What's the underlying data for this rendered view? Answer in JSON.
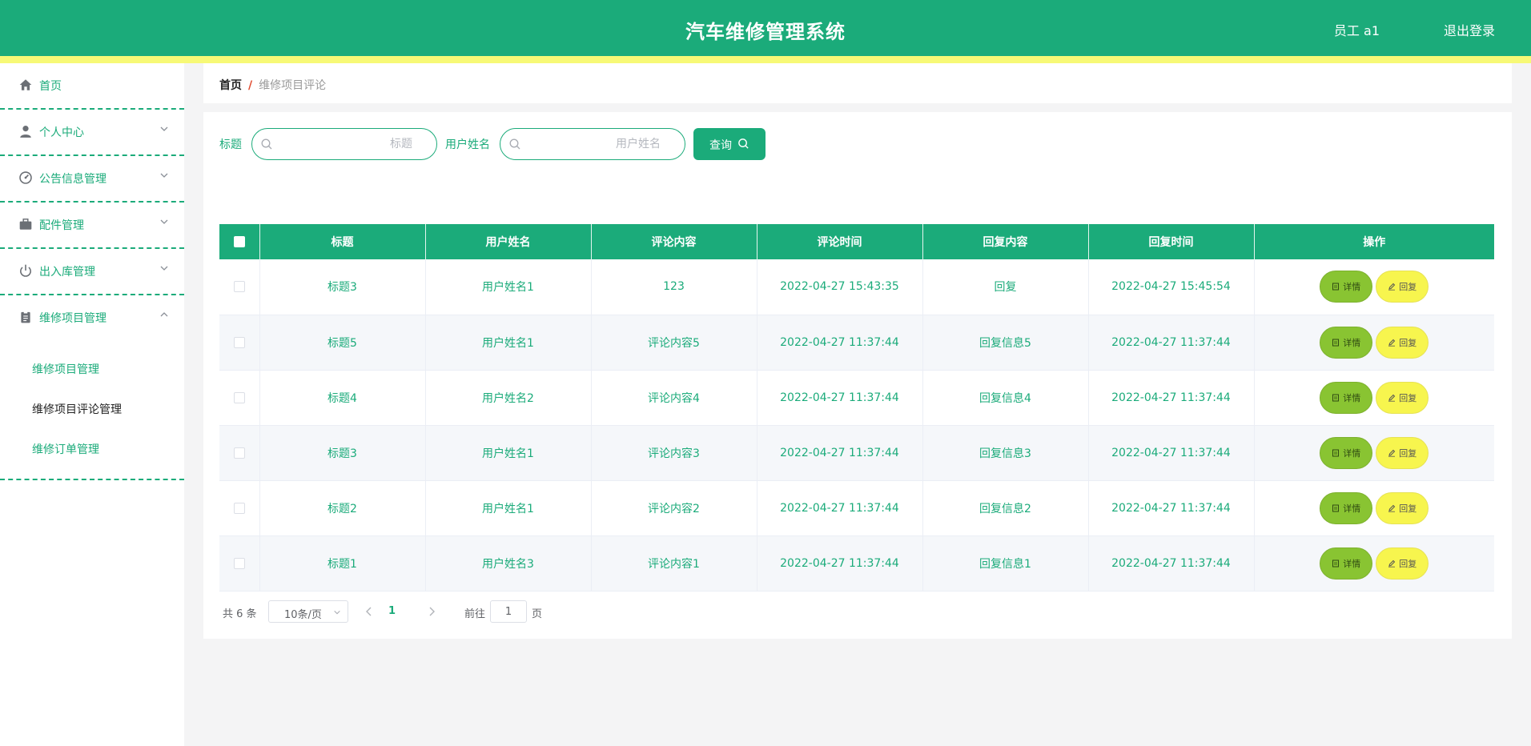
{
  "app": {
    "title": "汽车维修管理系统",
    "user": "员工 a1",
    "logout": "退出登录"
  },
  "colors": {
    "primary": "#1bab7a",
    "strip": "#f7f976",
    "detail_button": "#89c432",
    "reply_button": "#f7f54e"
  },
  "sidebar": {
    "items": [
      {
        "label": "首页",
        "icon": "home-icon"
      },
      {
        "label": "个人中心",
        "icon": "user-icon",
        "arrow": "chevron-down"
      },
      {
        "label": "公告信息管理",
        "icon": "gauge-icon",
        "arrow": "chevron-down"
      },
      {
        "label": "配件管理",
        "icon": "briefcase-icon",
        "arrow": "chevron-down"
      },
      {
        "label": "出入库管理",
        "icon": "power-icon",
        "arrow": "chevron-down"
      },
      {
        "label": "维修项目管理",
        "icon": "clipboard-icon",
        "arrow": "chevron-up",
        "expanded": true
      }
    ],
    "submenu": [
      {
        "label": "维修项目管理",
        "active": false
      },
      {
        "label": "维修项目评论管理",
        "active": true
      },
      {
        "label": "维修订单管理",
        "active": false
      }
    ]
  },
  "breadcrumb": {
    "home": "首页",
    "separator": "/",
    "current": "维修项目评论"
  },
  "search": {
    "title_label": "标题",
    "title_placeholder": "标题",
    "name_label": "用户姓名",
    "name_placeholder": "用户姓名",
    "query_label": "查询"
  },
  "table": {
    "headers": [
      "标题",
      "用户姓名",
      "评论内容",
      "评论时间",
      "回复内容",
      "回复时间",
      "操作"
    ],
    "rows": [
      {
        "title": "标题3",
        "user": "用户姓名1",
        "content": "123",
        "time": "2022-04-27 15:43:35",
        "reply": "回复",
        "reply_time": "2022-04-27 15:45:54"
      },
      {
        "title": "标题5",
        "user": "用户姓名1",
        "content": "评论内容5",
        "time": "2022-04-27 11:37:44",
        "reply": "回复信息5",
        "reply_time": "2022-04-27 11:37:44"
      },
      {
        "title": "标题4",
        "user": "用户姓名2",
        "content": "评论内容4",
        "time": "2022-04-27 11:37:44",
        "reply": "回复信息4",
        "reply_time": "2022-04-27 11:37:44"
      },
      {
        "title": "标题3",
        "user": "用户姓名1",
        "content": "评论内容3",
        "time": "2022-04-27 11:37:44",
        "reply": "回复信息3",
        "reply_time": "2022-04-27 11:37:44"
      },
      {
        "title": "标题2",
        "user": "用户姓名1",
        "content": "评论内容2",
        "time": "2022-04-27 11:37:44",
        "reply": "回复信息2",
        "reply_time": "2022-04-27 11:37:44"
      },
      {
        "title": "标题1",
        "user": "用户姓名3",
        "content": "评论内容1",
        "time": "2022-04-27 11:37:44",
        "reply": "回复信息1",
        "reply_time": "2022-04-27 11:37:44"
      }
    ],
    "actions": {
      "detail": "详情",
      "reply": "回复"
    }
  },
  "pagination": {
    "total": "共 6 条",
    "page_size": "10条/页",
    "current_page": "1",
    "goto_prefix": "前往",
    "goto_value": "1",
    "goto_suffix": "页"
  }
}
